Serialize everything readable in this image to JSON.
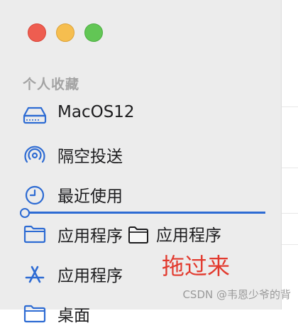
{
  "sidebar": {
    "section_title": "个人收藏",
    "items": [
      {
        "label": "MacOS12",
        "icon": "disk-icon"
      },
      {
        "label": "隔空投送",
        "icon": "airdrop-icon"
      },
      {
        "label": "最近使用",
        "icon": "clock-icon"
      },
      {
        "label": "应用程序",
        "icon": "folder-icon"
      },
      {
        "label": "应用程序",
        "icon": "app-store-icon"
      },
      {
        "label": "桌面",
        "icon": "folder-icon"
      }
    ]
  },
  "drag_ghost": {
    "label": "应用程序",
    "icon": "folder-icon"
  },
  "annotation": "拖过来",
  "watermark": "CSDN @韦恩少爷的背",
  "colors": {
    "accent": "#2d6bd3",
    "annotation": "#e23a2e",
    "close": "#ee5d50",
    "minimize": "#f6be4f",
    "maximize": "#62c655"
  }
}
